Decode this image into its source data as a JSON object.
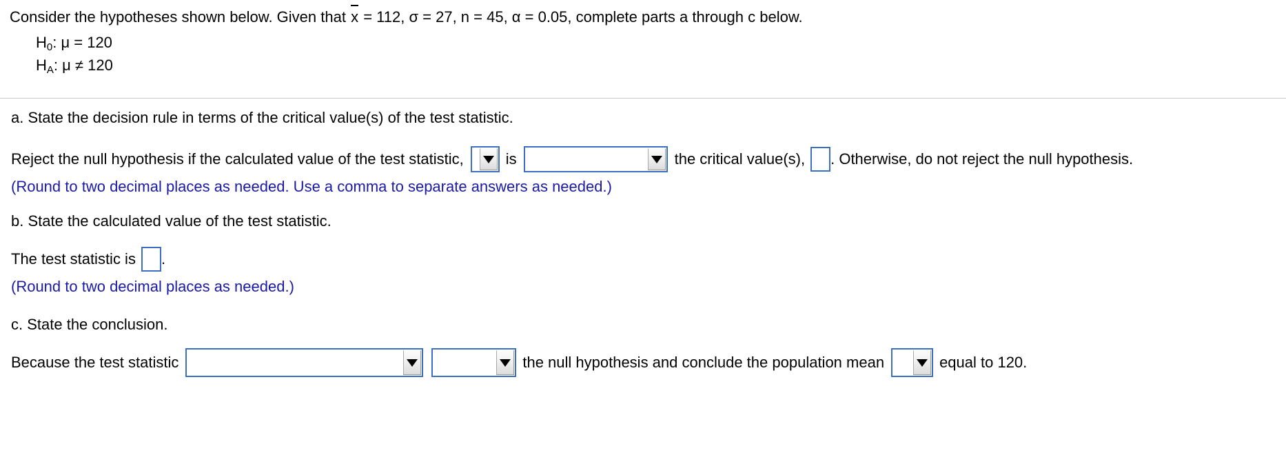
{
  "problem": {
    "intro_part1": "Consider the hypotheses shown below. Given that ",
    "intro_xbar": "x",
    "intro_part2": " = 112, σ = 27, n = 45, α = 0.05, complete parts a through c below.",
    "hypotheses": [
      {
        "symbol": "H",
        "subscript": "0",
        "statement": ": μ = 120"
      },
      {
        "symbol": "H",
        "subscript": "A",
        "statement": ": μ ≠ 120"
      }
    ]
  },
  "parts": {
    "a": {
      "prompt": "a. State the decision rule in terms of the critical value(s) of the test statistic.",
      "sentence_1": "Reject the null hypothesis if the calculated value of the test statistic,",
      "sentence_2": "is",
      "sentence_3": "the critical value(s),",
      "sentence_4": ". Otherwise, do not reject the null hypothesis.",
      "dropdown_1_value": "",
      "dropdown_2_value": "",
      "answer_value": "",
      "hint": "(Round to two decimal places as needed. Use a comma to separate answers as needed.)"
    },
    "b": {
      "prompt": "b. State the calculated value of the test statistic.",
      "sentence_1": "The test statistic is",
      "sentence_2": ".",
      "answer_value": "",
      "hint": "(Round to two decimal places as needed.)"
    },
    "c": {
      "prompt": "c. State the conclusion.",
      "sentence_1": "Because the test statistic",
      "sentence_2": "the null hypothesis and conclude the population mean",
      "sentence_3": "equal to 120.",
      "dropdown_1_value": "",
      "dropdown_2_value": "",
      "dropdown_3_value": ""
    }
  },
  "icons": {
    "dropdown_arrow": "chevron-down-icon"
  },
  "colors": {
    "field_border": "#3b6fc4",
    "hint_text": "#1a1aa6",
    "divider": "#c9c9c9",
    "page_background": "#ffffff"
  }
}
